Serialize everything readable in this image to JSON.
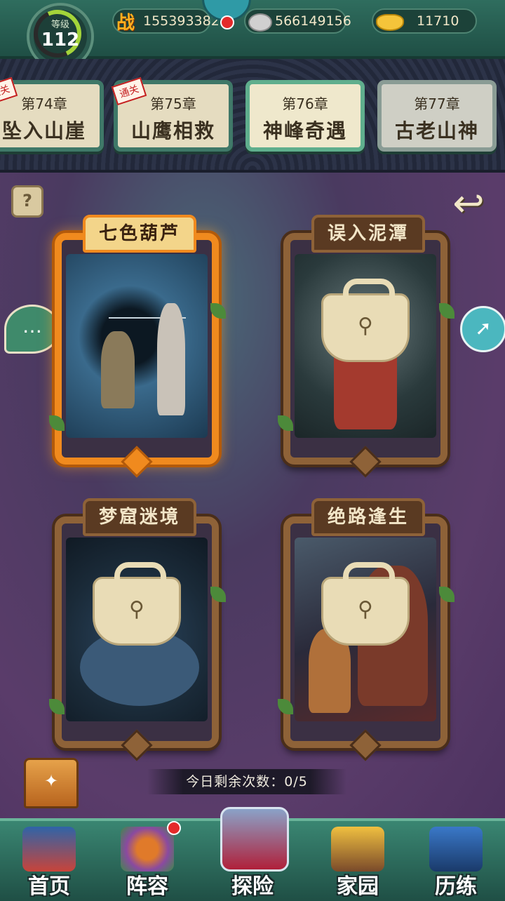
{
  "topbar": {
    "level_caption": "等级",
    "level_value": "112",
    "power_icon": "战",
    "power_value": "155393382",
    "coin_value": "566149156",
    "ingot_value": "11710"
  },
  "chapters": [
    {
      "num": "第74章",
      "name": "坠入山崖",
      "stamp": "通关",
      "state": "cleared"
    },
    {
      "num": "第75章",
      "name": "山鹰相救",
      "stamp": "通关",
      "state": "cleared"
    },
    {
      "num": "第76章",
      "name": "神峰奇遇",
      "stamp": "",
      "state": "active"
    },
    {
      "num": "第77章",
      "name": "古老山神",
      "stamp": "",
      "state": "locked"
    }
  ],
  "stages": [
    {
      "title": "七色葫芦",
      "locked": false
    },
    {
      "title": "误入泥潭",
      "locked": true
    },
    {
      "title": "梦窟迷境",
      "locked": true
    },
    {
      "title": "绝路逢生",
      "locked": true
    }
  ],
  "main": {
    "help_icon": "?",
    "attempts_label": "今日剩余次数：0/5"
  },
  "bottomnav": [
    {
      "label": "首页"
    },
    {
      "label": "阵容"
    },
    {
      "label": "探险"
    },
    {
      "label": "家园"
    },
    {
      "label": "历练"
    }
  ],
  "colors": {
    "accent_orange": "#f08a1e",
    "frame_green": "#3f7868",
    "background_purple": "#5a3c6a"
  },
  "icons": [
    "level-ring-icon",
    "power-icon",
    "coin-icon",
    "ingot-icon",
    "help-icon",
    "back-arrow-icon",
    "chat-icon",
    "rocket-icon",
    "lock-icon",
    "treasure-chest-icon"
  ]
}
